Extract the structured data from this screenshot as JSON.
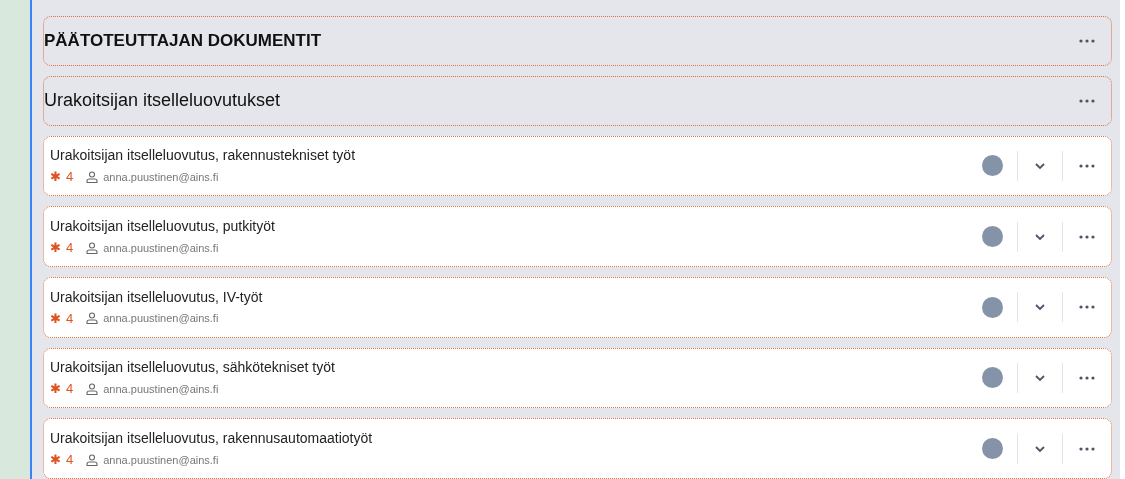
{
  "sections": [
    {
      "kind": "heading",
      "title": "PÄÄTOTEUTTAJAN DOKUMENTIT"
    },
    {
      "kind": "subheading",
      "title": "Urakoitsijan itselleluovutukset"
    },
    {
      "kind": "item",
      "title": "Urakoitsijan itselleluovutus, rakennustekniset työt",
      "marker": "✱",
      "count": "4",
      "user": "anna.puustinen@ains.fi"
    },
    {
      "kind": "item",
      "title": "Urakoitsijan itselleluovutus, putkityöt",
      "marker": "✱",
      "count": "4",
      "user": "anna.puustinen@ains.fi"
    },
    {
      "kind": "item",
      "title": "Urakoitsijan itselleluovutus, IV-työt",
      "marker": "✱",
      "count": "4",
      "user": "anna.puustinen@ains.fi"
    },
    {
      "kind": "item",
      "title": "Urakoitsijan itselleluovutus, sähkötekniset työt",
      "marker": "✱",
      "count": "4",
      "user": "anna.puustinen@ains.fi"
    },
    {
      "kind": "item",
      "title": "Urakoitsijan itselleluovutus, rakennusautomaatiotyöt",
      "marker": "✱",
      "count": "4",
      "user": "anna.puustinen@ains.fi"
    }
  ]
}
